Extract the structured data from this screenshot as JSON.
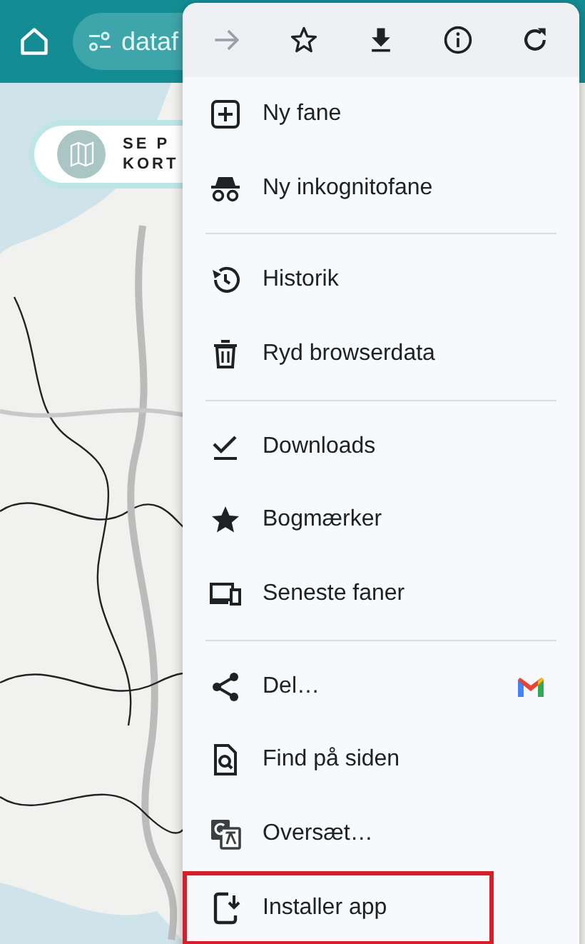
{
  "top_bar": {
    "address": "dataf"
  },
  "map_button": {
    "lines": [
      "SE P",
      "KORT"
    ]
  },
  "menu": {
    "toolbar": [
      {
        "disabled": true
      },
      {
        "disabled": false
      },
      {
        "disabled": false
      },
      {
        "disabled": false
      },
      {
        "disabled": false
      }
    ],
    "sections": [
      [
        {
          "label": "Ny fane",
          "highlighted": false
        },
        {
          "label": "Ny inkognitofane",
          "highlighted": false
        }
      ],
      [
        {
          "label": "Historik",
          "highlighted": false
        },
        {
          "label": "Ryd browserdata",
          "highlighted": false
        }
      ],
      [
        {
          "label": "Downloads",
          "highlighted": false
        },
        {
          "label": "Bogmærker",
          "highlighted": false
        },
        {
          "label": "Seneste faner",
          "highlighted": false
        }
      ],
      [
        {
          "label": "Del…",
          "highlighted": false,
          "mail_shortcut": true
        },
        {
          "label": "Find på siden",
          "highlighted": false
        },
        {
          "label": "Oversæt…",
          "highlighted": false
        },
        {
          "label": "Installer app",
          "highlighted": true
        }
      ]
    ]
  }
}
